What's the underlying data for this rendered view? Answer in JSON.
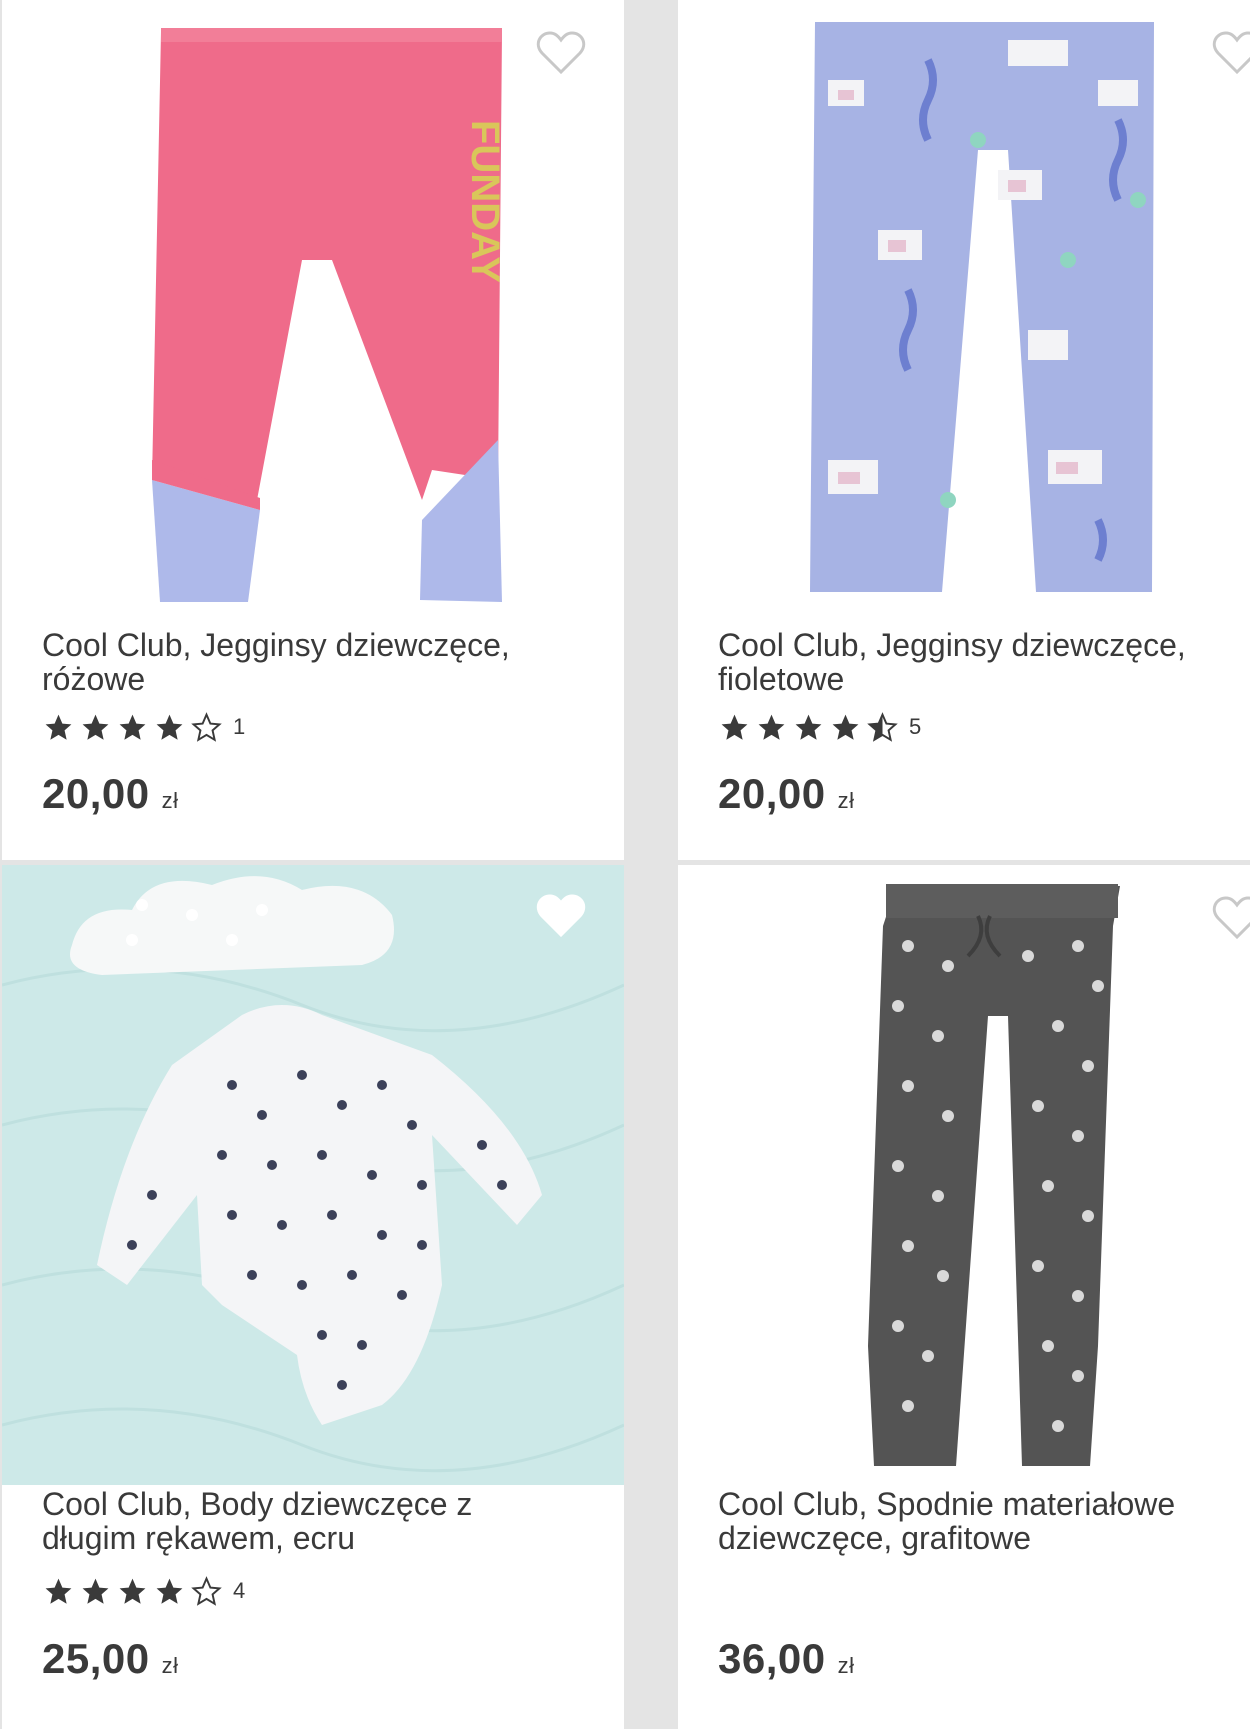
{
  "products": [
    {
      "name": "Cool Club, Jegginsy dziewczęce, różowe",
      "title_line1": "Cool Club, Jegginsy dziewczęce,",
      "title_line2": "różowe",
      "rating": 4,
      "rating_count": "1",
      "price": "20,00",
      "currency": "zł",
      "favorited": false
    },
    {
      "name": "Cool Club, Jegginsy dziewczęce, fioletowe",
      "title_line1": "Cool Club, Jegginsy dziewczęce,",
      "title_line2": "fioletowe",
      "rating": 4.5,
      "rating_count": "5",
      "price": "20,00",
      "currency": "zł",
      "favorited": false
    },
    {
      "name": "Cool Club, Body dziewczęce z długim rękawem, ecru",
      "title_line1": "Cool Club, Body dziewczęce z",
      "title_line2": "długim rękawem, ecru",
      "rating": 4,
      "rating_count": "4",
      "price": "25,00",
      "currency": "zł",
      "favorited": false
    },
    {
      "name": "Cool Club, Spodnie materiałowe dziewczęce, grafitowe",
      "title_line1": "Cool Club, Spodnie materiałowe",
      "title_line2": "dziewczęce, grafitowe",
      "rating": null,
      "rating_count": "",
      "price": "36,00",
      "currency": "zł",
      "favorited": false
    }
  ],
  "colors": {
    "text": "#3a3a3a",
    "star": "#3a3a3a",
    "heart_outline": "#c8c8c8",
    "separator": "#e4e4e4"
  },
  "icons": [
    "heart-icon",
    "star-icon",
    "star-half-icon",
    "star-empty-icon"
  ]
}
